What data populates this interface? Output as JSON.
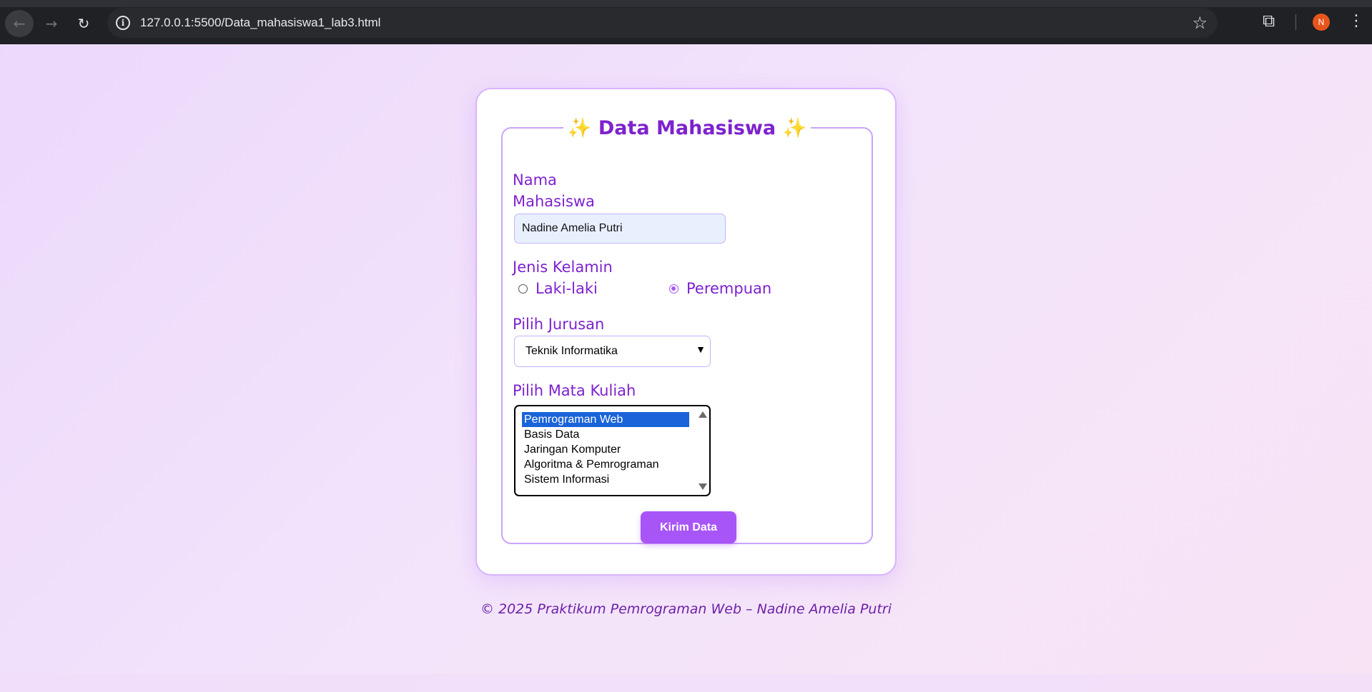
{
  "browser": {
    "url": "127.0.0.1:5500/Data_mahasiswa1_lab3.html",
    "avatar_initial": "N"
  },
  "form": {
    "title": "✨ Data Mahasiswa ✨",
    "name_label_line1": "Nama",
    "name_label_line2": "Mahasiswa",
    "name_value": "Nadine Amelia Putri",
    "gender_label": "Jenis Kelamin",
    "gender_options": [
      {
        "label": "Laki-laki",
        "checked": false
      },
      {
        "label": "Perempuan",
        "checked": true
      }
    ],
    "jurusan_label": "Pilih Jurusan",
    "jurusan_selected": "Teknik Informatika",
    "matkul_label": "Pilih Mata Kuliah",
    "matkul_options": [
      {
        "label": "Pemrograman Web",
        "selected": true
      },
      {
        "label": "Basis Data",
        "selected": false
      },
      {
        "label": "Jaringan Komputer",
        "selected": false
      },
      {
        "label": "Algoritma & Pemrograman",
        "selected": false
      },
      {
        "label": "Sistem Informasi",
        "selected": false
      }
    ],
    "submit_label": "Kirim Data"
  },
  "footer": {
    "text": "© 2025 Praktikum Pemrograman Web – Nadine Amelia Putri"
  },
  "colors": {
    "accent": "#a855f7",
    "label": "#7e22ce",
    "selection": "#1a63d9"
  }
}
